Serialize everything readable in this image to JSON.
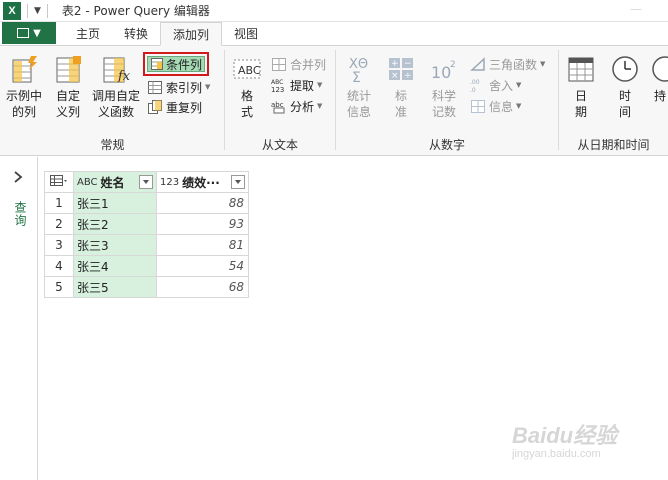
{
  "window": {
    "app_icon": "X",
    "title": "表2 - Power Query 编辑器"
  },
  "tabs": [
    "主页",
    "转换",
    "添加列",
    "视图"
  ],
  "active_tab": "添加列",
  "ribbon": {
    "general": {
      "label": "常规",
      "example_col": "示例中\n的列",
      "custom_col": "自定\n义列",
      "invoke_fn": "调用自定\n义函数",
      "conditional_col": "条件列",
      "index_col": "索引列",
      "duplicate_col": "重复列"
    },
    "from_text": {
      "label": "从文本",
      "format": "格\n式",
      "merge_cols": "合并列",
      "extract": "提取",
      "parse": "分析"
    },
    "from_number": {
      "label": "从数字",
      "statistics": "统计\n信息",
      "standard": "标\n准",
      "scientific": "科学\n记数",
      "trig": "三角函数",
      "rounding": "舍入",
      "information": "信息"
    },
    "from_datetime": {
      "label": "从日期和时间",
      "date": "日\n期",
      "time": "时\n间",
      "duration": "持"
    }
  },
  "left_pane": {
    "label": "查询"
  },
  "table": {
    "columns": [
      {
        "type_icon": "ABC",
        "name": "姓名"
      },
      {
        "type_icon": "123",
        "name": "绩效···"
      }
    ],
    "rows": [
      {
        "idx": "1",
        "name": "张三1",
        "value": "88"
      },
      {
        "idx": "2",
        "name": "张三2",
        "value": "93"
      },
      {
        "idx": "3",
        "name": "张三3",
        "value": "81"
      },
      {
        "idx": "4",
        "name": "张三4",
        "value": "54"
      },
      {
        "idx": "5",
        "name": "张三5",
        "value": "68"
      }
    ]
  },
  "watermark": {
    "main": "Baidu经验",
    "sub": "jingyan.baidu.com"
  },
  "colors": {
    "excel_green": "#217346",
    "highlight_red": "#d11a1a",
    "selected_column": "#d8f1de"
  }
}
